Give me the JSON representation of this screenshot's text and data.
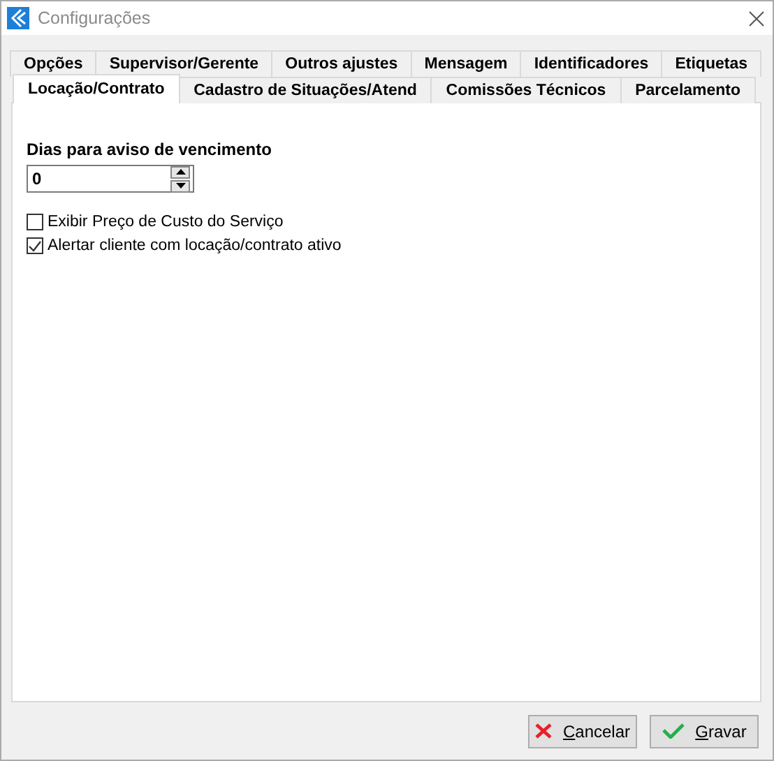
{
  "window": {
    "title": "Configurações"
  },
  "tab_rows": [
    [
      {
        "label": "Opções",
        "selected": false
      },
      {
        "label": "Supervisor/Gerente",
        "selected": false
      },
      {
        "label": "Outros ajustes",
        "selected": false
      },
      {
        "label": "Mensagem",
        "selected": false
      },
      {
        "label": "Identificadores",
        "selected": false
      },
      {
        "label": "Etiquetas",
        "selected": false
      }
    ],
    [
      {
        "label": "Locação/Contrato",
        "selected": true
      },
      {
        "label": "Cadastro de Situações/Atend",
        "selected": false
      },
      {
        "label": "Comissões Técnicos",
        "selected": false
      },
      {
        "label": "Parcelamento",
        "selected": false
      }
    ]
  ],
  "days_field": {
    "label": "Dias para aviso de vencimento",
    "value": "0"
  },
  "checkboxes": [
    {
      "label": "Exibir Preço de Custo do Serviço",
      "checked": false
    },
    {
      "label": "Alertar cliente com locação/contrato ativo",
      "checked": true
    }
  ],
  "buttons": [
    {
      "kind": "cancel",
      "label": "Cancelar"
    },
    {
      "kind": "save",
      "label": "Gravar"
    }
  ]
}
